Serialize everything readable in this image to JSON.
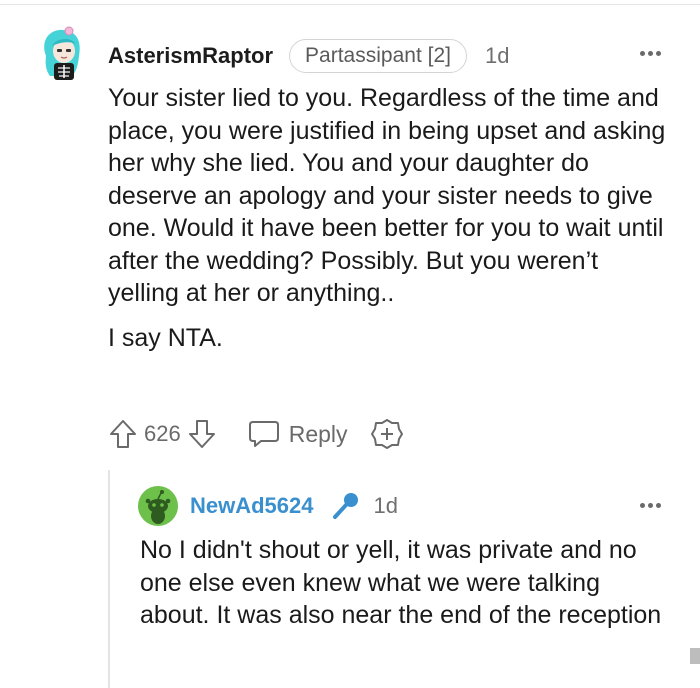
{
  "comment": {
    "username": "AsterismRaptor",
    "flair": "Partassipant [2]",
    "time": "1d",
    "body": [
      "Your sister lied to you. Regardless of the time and place, you were justified in being upset and asking her why she lied. You and your daughter do deserve an apology and your sister needs to give one. Would it have been better for you to wait until after the wedding? Possibly. But you weren’t yelling at her or anything..",
      "I say NTA."
    ],
    "votes": "626",
    "reply_label": "Reply"
  },
  "reply": {
    "username": "NewAd5624",
    "time": "1d",
    "body": "No I didn't shout or yell, it was private and no one else even knew what we were talking about. It was also near the end of the reception"
  },
  "colors": {
    "reply_username": "#3a90cf",
    "snoo_green": "#6dc04a",
    "avatar_hair": "#46d3d8",
    "muted_text": "#6a6a6a"
  },
  "icons": {
    "upvote": "arrow-up-outline-icon",
    "downvote": "arrow-down-outline-icon",
    "reply": "speech-bubble-icon",
    "award": "plus-badge-icon",
    "more": "three-dots-icon",
    "mic": "microphone-icon"
  }
}
